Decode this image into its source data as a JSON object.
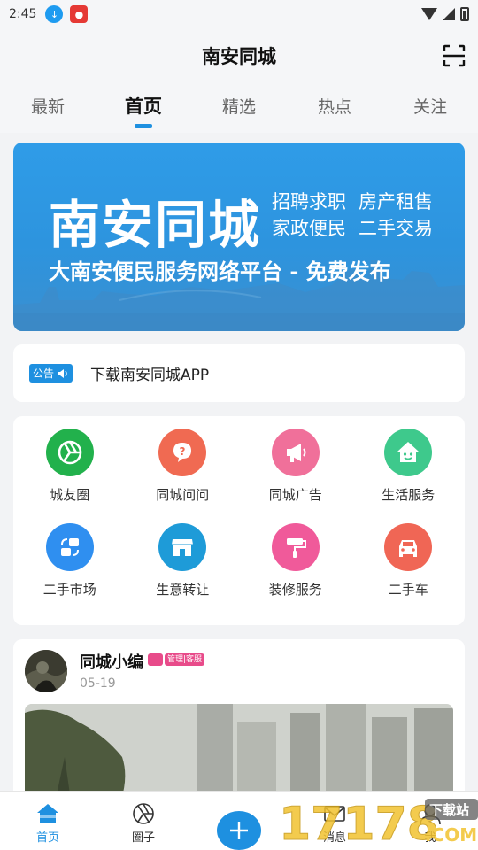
{
  "status_bar": {
    "time": "2:45"
  },
  "header": {
    "title": "南安同城"
  },
  "tabs": [
    {
      "label": "最新"
    },
    {
      "label": "首页"
    },
    {
      "label": "精选"
    },
    {
      "label": "热点"
    },
    {
      "label": "关注"
    }
  ],
  "active_tab": "首页",
  "banner": {
    "title": "南安同城",
    "tags_row1": [
      "招聘求职",
      "房产租售"
    ],
    "tags_row2": [
      "家政便民",
      "二手交易"
    ],
    "subtitle": "大南安便民服务网络平台 - 免费发布"
  },
  "notice": {
    "badge": "公告",
    "text": "下载南安同城APP"
  },
  "services": [
    {
      "label": "城友圈",
      "color": "#22b14c",
      "icon": "aperture-icon"
    },
    {
      "label": "同城问问",
      "color": "#f06a52",
      "icon": "question-icon"
    },
    {
      "label": "同城广告",
      "color": "#f0709a",
      "icon": "megaphone-icon"
    },
    {
      "label": "生活服务",
      "color": "#3ec98c",
      "icon": "house-smile-icon"
    },
    {
      "label": "二手市场",
      "color": "#2f8ff0",
      "icon": "exchange-icon"
    },
    {
      "label": "生意转让",
      "color": "#1e9bd8",
      "icon": "store-icon"
    },
    {
      "label": "装修服务",
      "color": "#f05a9a",
      "icon": "paint-roller-icon"
    },
    {
      "label": "二手车",
      "color": "#f06655",
      "icon": "car-icon"
    }
  ],
  "post": {
    "author": "同城小编",
    "role_badge": "管理|客服",
    "date": "05-19"
  },
  "bottom_nav": [
    {
      "label": "首页"
    },
    {
      "label": "圈子"
    },
    {
      "label": ""
    },
    {
      "label": "消息"
    },
    {
      "label": "我"
    }
  ],
  "watermark": {
    "text": "17178",
    "badge": "下载站",
    "suffix": ".COM"
  },
  "colors": {
    "accent": "#1e90e0",
    "banner": "#2f9ce8"
  }
}
